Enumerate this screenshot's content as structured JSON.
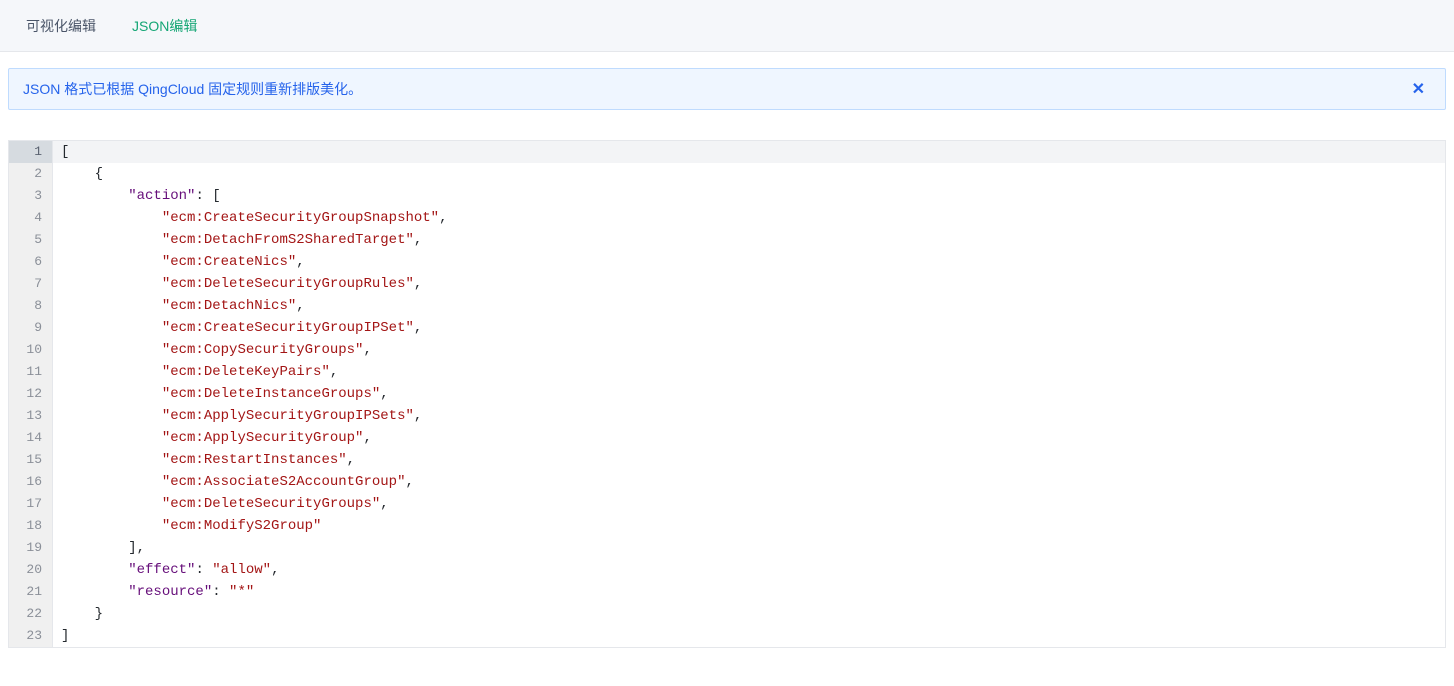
{
  "tabs": {
    "visual": "可视化编辑",
    "json": "JSON编辑"
  },
  "alert": {
    "message": "JSON 格式已根据 QingCloud 固定规则重新排版美化。",
    "close": "✕"
  },
  "editor": {
    "lines": [
      {
        "n": 1,
        "indent": 0,
        "tokens": [
          {
            "t": "punc",
            "v": "["
          }
        ],
        "active": true
      },
      {
        "n": 2,
        "indent": 1,
        "tokens": [
          {
            "t": "punc",
            "v": "{"
          }
        ]
      },
      {
        "n": 3,
        "indent": 2,
        "tokens": [
          {
            "t": "key",
            "v": "\"action\""
          },
          {
            "t": "punc",
            "v": ": ["
          }
        ]
      },
      {
        "n": 4,
        "indent": 3,
        "tokens": [
          {
            "t": "str",
            "v": "\"ecm:CreateSecurityGroupSnapshot\""
          },
          {
            "t": "punc",
            "v": ","
          }
        ]
      },
      {
        "n": 5,
        "indent": 3,
        "tokens": [
          {
            "t": "str",
            "v": "\"ecm:DetachFromS2SharedTarget\""
          },
          {
            "t": "punc",
            "v": ","
          }
        ]
      },
      {
        "n": 6,
        "indent": 3,
        "tokens": [
          {
            "t": "str",
            "v": "\"ecm:CreateNics\""
          },
          {
            "t": "punc",
            "v": ","
          }
        ]
      },
      {
        "n": 7,
        "indent": 3,
        "tokens": [
          {
            "t": "str",
            "v": "\"ecm:DeleteSecurityGroupRules\""
          },
          {
            "t": "punc",
            "v": ","
          }
        ]
      },
      {
        "n": 8,
        "indent": 3,
        "tokens": [
          {
            "t": "str",
            "v": "\"ecm:DetachNics\""
          },
          {
            "t": "punc",
            "v": ","
          }
        ]
      },
      {
        "n": 9,
        "indent": 3,
        "tokens": [
          {
            "t": "str",
            "v": "\"ecm:CreateSecurityGroupIPSet\""
          },
          {
            "t": "punc",
            "v": ","
          }
        ]
      },
      {
        "n": 10,
        "indent": 3,
        "tokens": [
          {
            "t": "str",
            "v": "\"ecm:CopySecurityGroups\""
          },
          {
            "t": "punc",
            "v": ","
          }
        ]
      },
      {
        "n": 11,
        "indent": 3,
        "tokens": [
          {
            "t": "str",
            "v": "\"ecm:DeleteKeyPairs\""
          },
          {
            "t": "punc",
            "v": ","
          }
        ]
      },
      {
        "n": 12,
        "indent": 3,
        "tokens": [
          {
            "t": "str",
            "v": "\"ecm:DeleteInstanceGroups\""
          },
          {
            "t": "punc",
            "v": ","
          }
        ]
      },
      {
        "n": 13,
        "indent": 3,
        "tokens": [
          {
            "t": "str",
            "v": "\"ecm:ApplySecurityGroupIPSets\""
          },
          {
            "t": "punc",
            "v": ","
          }
        ]
      },
      {
        "n": 14,
        "indent": 3,
        "tokens": [
          {
            "t": "str",
            "v": "\"ecm:ApplySecurityGroup\""
          },
          {
            "t": "punc",
            "v": ","
          }
        ]
      },
      {
        "n": 15,
        "indent": 3,
        "tokens": [
          {
            "t": "str",
            "v": "\"ecm:RestartInstances\""
          },
          {
            "t": "punc",
            "v": ","
          }
        ]
      },
      {
        "n": 16,
        "indent": 3,
        "tokens": [
          {
            "t": "str",
            "v": "\"ecm:AssociateS2AccountGroup\""
          },
          {
            "t": "punc",
            "v": ","
          }
        ]
      },
      {
        "n": 17,
        "indent": 3,
        "tokens": [
          {
            "t": "str",
            "v": "\"ecm:DeleteSecurityGroups\""
          },
          {
            "t": "punc",
            "v": ","
          }
        ]
      },
      {
        "n": 18,
        "indent": 3,
        "tokens": [
          {
            "t": "str",
            "v": "\"ecm:ModifyS2Group\""
          }
        ]
      },
      {
        "n": 19,
        "indent": 2,
        "tokens": [
          {
            "t": "punc",
            "v": "],"
          }
        ]
      },
      {
        "n": 20,
        "indent": 2,
        "tokens": [
          {
            "t": "key",
            "v": "\"effect\""
          },
          {
            "t": "punc",
            "v": ": "
          },
          {
            "t": "str",
            "v": "\"allow\""
          },
          {
            "t": "punc",
            "v": ","
          }
        ]
      },
      {
        "n": 21,
        "indent": 2,
        "tokens": [
          {
            "t": "key",
            "v": "\"resource\""
          },
          {
            "t": "punc",
            "v": ": "
          },
          {
            "t": "str",
            "v": "\"*\""
          }
        ]
      },
      {
        "n": 22,
        "indent": 1,
        "tokens": [
          {
            "t": "punc",
            "v": "}"
          }
        ]
      },
      {
        "n": 23,
        "indent": 0,
        "tokens": [
          {
            "t": "punc",
            "v": "]"
          }
        ]
      }
    ]
  }
}
